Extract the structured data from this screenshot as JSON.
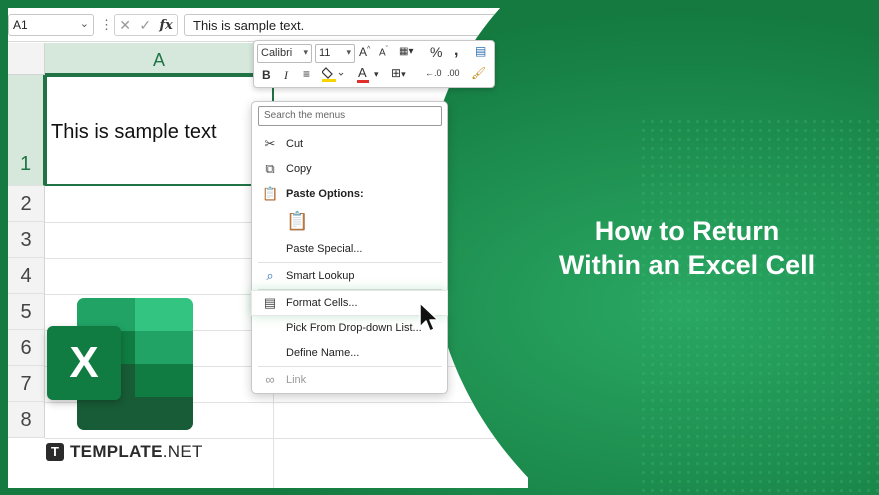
{
  "formula_bar": {
    "name_box": "A1",
    "cancel_symbol": "✕",
    "enter_symbol": "✓",
    "fx_label": "fx",
    "formula": "This is sample text."
  },
  "sheet": {
    "column_header": "A",
    "rows": [
      "1",
      "2",
      "3",
      "4",
      "5",
      "6",
      "7",
      "8"
    ],
    "cell_a1": "This is sample text"
  },
  "mini_toolbar": {
    "font": "Calibri",
    "size": "11",
    "icons": [
      "grow-font-icon",
      "shrink-font-icon",
      "number-format-icon",
      "percent-icon",
      "comma-icon",
      "format-table-icon",
      "bold-icon",
      "italic-icon",
      "align-icon",
      "fill-color-icon",
      "font-color-icon",
      "borders-icon",
      "decrease-decimal-icon",
      "increase-decimal-icon",
      "format-painter-icon"
    ],
    "bold": "B",
    "italic": "I",
    "font_color_letter": "A",
    "accent_red": "#e0302b",
    "accent_yellow": "#f5d400"
  },
  "context_menu": {
    "search_placeholder": "Search the menus",
    "items": {
      "cut": "Cut",
      "copy": "Copy",
      "paste_options": "Paste Options:",
      "paste_special": "Paste Special...",
      "smart_lookup": "Smart Lookup",
      "format_cells": "Format Cells...",
      "pick_dropdown": "Pick From Drop-down List...",
      "define_name": "Define Name...",
      "link": "Link"
    }
  },
  "logo": {
    "letter": "X"
  },
  "brand": {
    "mark": "T",
    "name_bold": "TEMPLATE",
    "name_rest": ".NET"
  },
  "headline": {
    "line1": "How to Return",
    "line2": "Within an Excel Cell"
  },
  "colors": {
    "excel_green": "#217346",
    "panel_green": "#1c8a4b",
    "panel_dark": "#0f6b3a"
  }
}
